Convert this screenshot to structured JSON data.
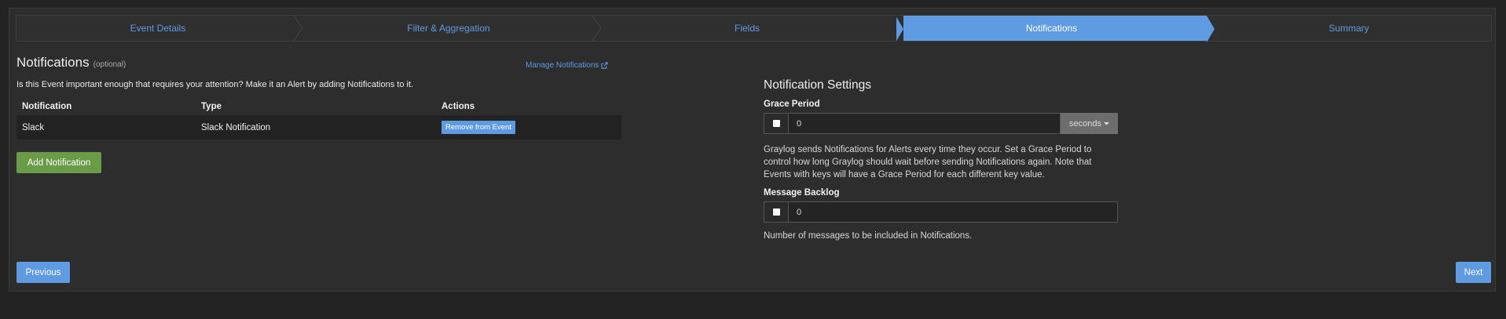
{
  "wizard": {
    "steps": [
      {
        "label": "Event Details",
        "active": false
      },
      {
        "label": "Filter & Aggregation",
        "active": false
      },
      {
        "label": "Fields",
        "active": false
      },
      {
        "label": "Notifications",
        "active": true
      },
      {
        "label": "Summary",
        "active": false
      }
    ]
  },
  "notifications": {
    "title": "Notifications",
    "optional": "(optional)",
    "manage_link": "Manage Notifications",
    "intro": "Is this Event important enough that requires your attention? Make it an Alert by adding Notifications to it.",
    "columns": [
      "Notification",
      "Type",
      "Actions"
    ],
    "rows": [
      {
        "notification": "Slack",
        "type": "Slack Notification",
        "action": "Remove from Event"
      }
    ],
    "add_button": "Add Notification"
  },
  "settings": {
    "title": "Notification Settings",
    "grace_period": {
      "label": "Grace Period",
      "value": "0",
      "unit": "seconds",
      "help": "Graylog sends Notifications for Alerts every time they occur. Set a Grace Period to control how long Graylog should wait before sending Notifications again. Note that Events with keys will have a Grace Period for each different key value."
    },
    "backlog": {
      "label": "Message Backlog",
      "value": "0",
      "help": "Number of messages to be included in Notifications."
    }
  },
  "nav": {
    "previous": "Previous",
    "next": "Next"
  },
  "colors": {
    "accent": "#5f9be3",
    "success": "#6a9b46",
    "background": "#2d2d2d"
  }
}
